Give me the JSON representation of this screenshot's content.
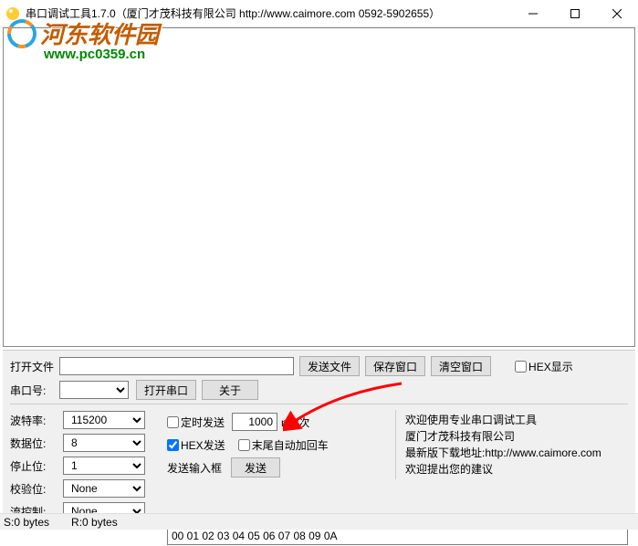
{
  "window": {
    "title": "串口调试工具1.7.0（厦门才茂科技有限公司 http://www.caimore.com 0592-5902655）"
  },
  "watermark": {
    "text": "河东软件园",
    "url": "www.pc0359.cn"
  },
  "fileRow": {
    "openFile": "打开文件",
    "sendFile": "发送文件",
    "saveWindow": "保存窗口",
    "clearWindow": "清空窗口",
    "hexShow": "HEX显示"
  },
  "portRow": {
    "portLabel": "串口号:",
    "openPort": "打开串口",
    "about": "关于"
  },
  "config": {
    "baudLabel": "波特率:",
    "baudValue": "115200",
    "dataLabel": "数据位:",
    "dataValue": "8",
    "stopLabel": "停止位:",
    "stopValue": "1",
    "parityLabel": "校验位:",
    "parityValue": "None",
    "flowLabel": "流控制:",
    "flowValue": "None"
  },
  "mid": {
    "timedSend": "定时发送",
    "interval": "1000",
    "unit": "ms/次",
    "hexSend": "HEX发送",
    "autoCR": "末尾自动加回车",
    "inputLabel": "发送输入框",
    "sendBtn": "发送"
  },
  "info": {
    "l1": "欢迎使用专业串口调试工具",
    "l2": "厦门才茂科技有限公司",
    "l3": "最新版下载地址:http://www.caimore.com",
    "l4": "欢迎提出您的建议"
  },
  "sendData": "00 01 02 03 04 05 06 07 08 09 0A",
  "status": {
    "s": "S:0 bytes",
    "r": "R:0 bytes"
  }
}
